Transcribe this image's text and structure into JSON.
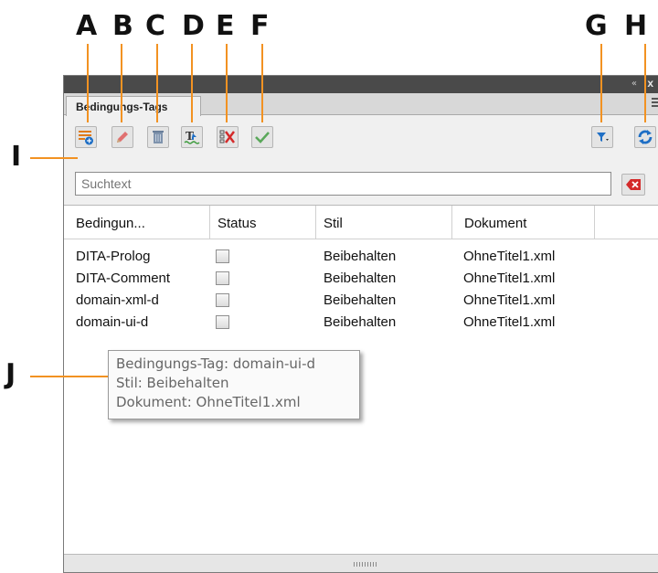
{
  "callouts": [
    "A",
    "B",
    "C",
    "D",
    "E",
    "F",
    "G",
    "H",
    "I",
    "J"
  ],
  "panel": {
    "tab_label": "Bedingungs-Tags",
    "collapse_glyph": "«",
    "close_glyph": "x"
  },
  "toolbar": {
    "buttons": [
      {
        "icon": "new-tag-icon"
      },
      {
        "icon": "edit-pencil-icon"
      },
      {
        "icon": "trash-icon"
      },
      {
        "icon": "apply-tag-icon"
      },
      {
        "icon": "remove-tag-icon"
      },
      {
        "icon": "checkmark-icon"
      },
      {
        "icon": "filter-icon"
      },
      {
        "icon": "refresh-icon"
      }
    ]
  },
  "search": {
    "placeholder": "Suchtext",
    "clear_icon": "clear-search-icon"
  },
  "table": {
    "columns": [
      "Bedingun...",
      "Status",
      "Stil",
      "Dokument"
    ],
    "rows": [
      {
        "name": "DITA-Prolog",
        "status": false,
        "style": "Beibehalten",
        "document": "OhneTitel1.xml"
      },
      {
        "name": "DITA-Comment",
        "status": false,
        "style": "Beibehalten",
        "document": "OhneTitel1.xml"
      },
      {
        "name": "domain-xml-d",
        "status": false,
        "style": "Beibehalten",
        "document": "OhneTitel1.xml"
      },
      {
        "name": "domain-ui-d",
        "status": false,
        "style": "Beibehalten",
        "document": "OhneTitel1.xml"
      }
    ]
  },
  "tooltip": {
    "line1": "Bedingungs-Tag: domain-ui-d",
    "line2": "Stil: Beibehalten",
    "line3": "Dokument: OhneTitel1.xml"
  },
  "colors": {
    "callout": "#f29222",
    "blue_icon": "#1f6fc5",
    "red_icon": "#d42a2a",
    "green_icon": "#3a9a3a"
  }
}
